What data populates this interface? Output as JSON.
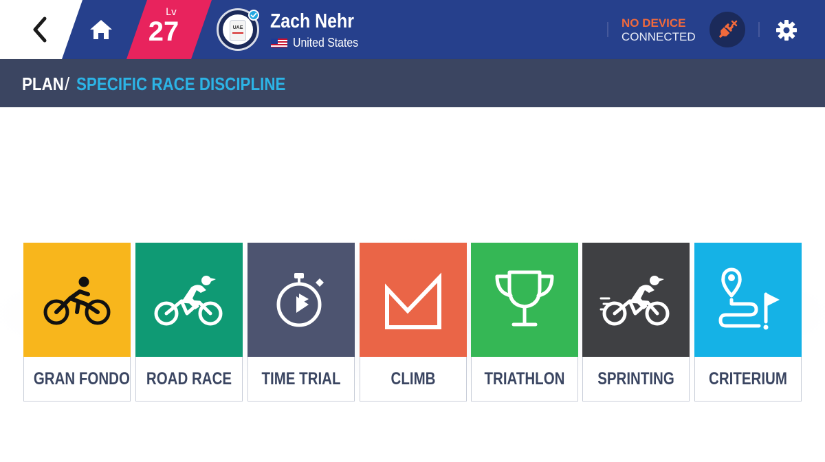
{
  "header": {
    "level_label": "Lv",
    "level": "27",
    "user_name": "Zach Nehr",
    "country": "United States",
    "jersey_text": "UAE",
    "device_status_line1": "NO DEVICE",
    "device_status_line2": "CONNECTED"
  },
  "breadcrumb": {
    "root": "PLAN",
    "separator": "/",
    "current": "SPECIFIC RACE DISCIPLINE"
  },
  "colors": {
    "header_bg": "#26408c",
    "level_badge": "#e8235d",
    "breadcrumb_bg": "#3b4561",
    "breadcrumb_active": "#2cb4e6",
    "warning": "#f26a3c"
  },
  "disciplines": [
    {
      "label": "GRAN FONDO",
      "icon": "cyclist-icon",
      "color": "#f8b61c"
    },
    {
      "label": "ROAD RACE",
      "icon": "road-bike-icon",
      "color": "#0f9a74"
    },
    {
      "label": "TIME TRIAL",
      "icon": "stopwatch-icon",
      "color": "#4d5470"
    },
    {
      "label": "CLIMB",
      "icon": "mountain-climb-icon",
      "color": "#ea6547"
    },
    {
      "label": "TRIATHLON",
      "icon": "trophy-icon",
      "color": "#35b755"
    },
    {
      "label": "SPRINTING",
      "icon": "sprint-bike-icon",
      "color": "#3f4043"
    },
    {
      "label": "CRITERIUM",
      "icon": "route-flag-icon",
      "color": "#15b2e6"
    }
  ]
}
